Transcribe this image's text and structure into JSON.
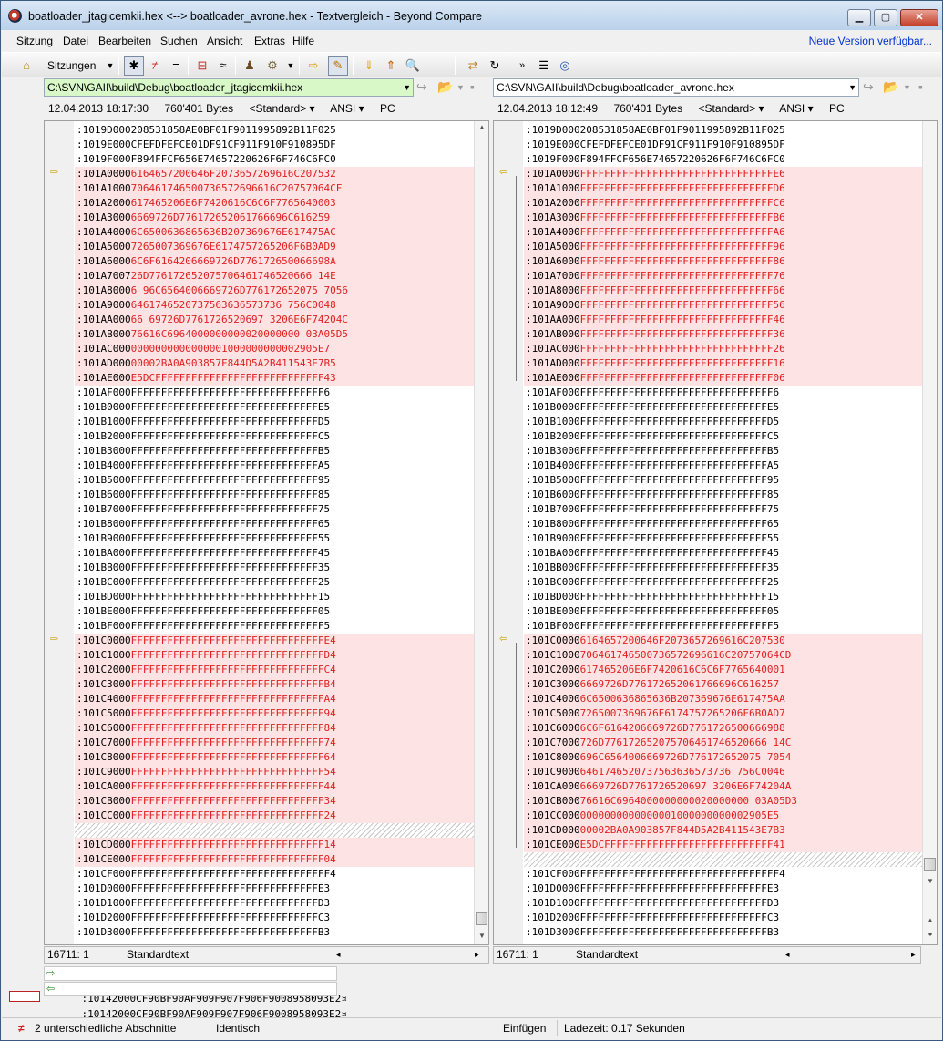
{
  "window": {
    "title": "boatloader_jtagicemkii.hex <--> boatloader_avrone.hex - Textvergleich - Beyond Compare",
    "minimize": "▁",
    "maximize": "▢",
    "close": "✕"
  },
  "menu": {
    "items": [
      "Sitzung",
      "Datei",
      "Bearbeiten",
      "Suchen",
      "Ansicht",
      "Extras",
      "Hilfe"
    ],
    "update_link": "Neue Version verfügbar..."
  },
  "toolbar": {
    "sessions_label": "Sitzungen",
    "icons": [
      "home-icon",
      "asterisk-filter-icon",
      "not-equal-icon",
      "equal-icon",
      "context-icon",
      "similar-icon",
      "rules-icon",
      "format-icon",
      "next-diff-icon",
      "edit-icon",
      "next-section-icon",
      "prev-section-icon",
      "find-icon",
      "swap-icon",
      "refresh-icon",
      "expand-icon",
      "report-icon",
      "web-icon"
    ]
  },
  "left": {
    "path": "C:\\SVN\\GAII\\build\\Debug\\boatloader_jtagicemkii.hex",
    "date": "12.04.2013 18:17:30",
    "size": "760'401 Bytes",
    "format": "<Standard> ▾",
    "encoding": "ANSI ▾",
    "lineend": "PC",
    "position": "16711: 1",
    "mode": "Standardtext",
    "lines": [
      {
        "t": ":1019D000208531858AE0BF01F9011995892B11F025",
        "d": 0
      },
      {
        "t": ":1019E000CFEFDFEFCE01DF91CF911F910F910895DF",
        "d": 0
      },
      {
        "t": ":1019F000F894FFCF656E74657220626F6F746C6FC0",
        "d": 0
      },
      {
        "t": ":101A00006164657200646F2073657269616C207532",
        "d": 1
      },
      {
        "t": ":101A1000706461746500736572696616C20757064CF",
        "d": 1
      },
      {
        "t": ":101A2000617465206E6F7420616C6C6F7765640003",
        "d": 1
      },
      {
        "t": ":101A30006669726D776172652061766696C616259",
        "d": 1
      },
      {
        "t": ":101A40006C6500636865636B207369676E617475AC",
        "d": 1
      },
      {
        "t": ":101A50007265007369676E6174757265206F6B0AD9",
        "d": 1
      },
      {
        "t": ":101A60006C6F6164206669726D776172650066698A",
        "d": 1
      },
      {
        "t": ":101A700726D776172652075706461746520666 14E",
        "d": 1
      },
      {
        "t": ":101A80006 96C6564006669726D776172652075 7056",
        "d": 1
      },
      {
        "t": ":101A90006461746520737563636573736 756C0048",
        "d": 1
      },
      {
        "t": ":101AA00066 69726D7761726520697 3206E6F74204C",
        "d": 1
      },
      {
        "t": ":101AB00076616C6964000000000020000000 03A05D5",
        "d": 1
      },
      {
        "t": ":101AC0000000000000000001000000000002905E7",
        "d": 1
      },
      {
        "t": ":101AD00000002BA0A903857F844D5A2B411543E7B5",
        "d": 1
      },
      {
        "t": ":101AE000E5DCFFFFFFFFFFFFFFFFFFFFFFFFFFFF43",
        "d": 1
      },
      {
        "t": ":101AF000FFFFFFFFFFFFFFFFFFFFFFFFFFFFFFFF6",
        "d": 0
      },
      {
        "t": ":101B0000FFFFFFFFFFFFFFFFFFFFFFFFFFFFFFFE5",
        "d": 0
      },
      {
        "t": ":101B1000FFFFFFFFFFFFFFFFFFFFFFFFFFFFFFFD5",
        "d": 0
      },
      {
        "t": ":101B2000FFFFFFFFFFFFFFFFFFFFFFFFFFFFFFFC5",
        "d": 0
      },
      {
        "t": ":101B3000FFFFFFFFFFFFFFFFFFFFFFFFFFFFFFFB5",
        "d": 0
      },
      {
        "t": ":101B4000FFFFFFFFFFFFFFFFFFFFFFFFFFFFFFFA5",
        "d": 0
      },
      {
        "t": ":101B5000FFFFFFFFFFFFFFFFFFFFFFFFFFFFFFF95",
        "d": 0
      },
      {
        "t": ":101B6000FFFFFFFFFFFFFFFFFFFFFFFFFFFFFFF85",
        "d": 0
      },
      {
        "t": ":101B7000FFFFFFFFFFFFFFFFFFFFFFFFFFFFFFF75",
        "d": 0
      },
      {
        "t": ":101B8000FFFFFFFFFFFFFFFFFFFFFFFFFFFFFFF65",
        "d": 0
      },
      {
        "t": ":101B9000FFFFFFFFFFFFFFFFFFFFFFFFFFFFFFF55",
        "d": 0
      },
      {
        "t": ":101BA000FFFFFFFFFFFFFFFFFFFFFFFFFFFFFFF45",
        "d": 0
      },
      {
        "t": ":101BB000FFFFFFFFFFFFFFFFFFFFFFFFFFFFFFF35",
        "d": 0
      },
      {
        "t": ":101BC000FFFFFFFFFFFFFFFFFFFFFFFFFFFFFFF25",
        "d": 0
      },
      {
        "t": ":101BD000FFFFFFFFFFFFFFFFFFFFFFFFFFFFFFF15",
        "d": 0
      },
      {
        "t": ":101BE000FFFFFFFFFFFFFFFFFFFFFFFFFFFFFFF05",
        "d": 0
      },
      {
        "t": ":101BF000FFFFFFFFFFFFFFFFFFFFFFFFFFFFFFFF5",
        "d": 0
      },
      {
        "t": ":101C0000FFFFFFFFFFFFFFFFFFFFFFFFFFFFFFFFE4",
        "d": 1
      },
      {
        "t": ":101C1000FFFFFFFFFFFFFFFFFFFFFFFFFFFFFFFFD4",
        "d": 1
      },
      {
        "t": ":101C2000FFFFFFFFFFFFFFFFFFFFFFFFFFFFFFFFC4",
        "d": 1
      },
      {
        "t": ":101C3000FFFFFFFFFFFFFFFFFFFFFFFFFFFFFFFFB4",
        "d": 1
      },
      {
        "t": ":101C4000FFFFFFFFFFFFFFFFFFFFFFFFFFFFFFFFA4",
        "d": 1
      },
      {
        "t": ":101C5000FFFFFFFFFFFFFFFFFFFFFFFFFFFFFFFF94",
        "d": 1
      },
      {
        "t": ":101C6000FFFFFFFFFFFFFFFFFFFFFFFFFFFFFFFF84",
        "d": 1
      },
      {
        "t": ":101C7000FFFFFFFFFFFFFFFFFFFFFFFFFFFFFFFF74",
        "d": 1
      },
      {
        "t": ":101C8000FFFFFFFFFFFFFFFFFFFFFFFFFFFFFFFF64",
        "d": 1
      },
      {
        "t": ":101C9000FFFFFFFFFFFFFFFFFFFFFFFFFFFFFFFF54",
        "d": 1
      },
      {
        "t": ":101CA000FFFFFFFFFFFFFFFFFFFFFFFFFFFFFFFF44",
        "d": 1
      },
      {
        "t": ":101CB000FFFFFFFFFFFFFFFFFFFFFFFFFFFFFFFF34",
        "d": 1
      },
      {
        "t": ":101CC000FFFFFFFFFFFFFFFFFFFFFFFFFFFFFFFF24",
        "d": 1
      },
      {
        "t": "",
        "d": 2
      },
      {
        "t": ":101CD000FFFFFFFFFFFFFFFFFFFFFFFFFFFFFFFF14",
        "d": 1
      },
      {
        "t": ":101CE000FFFFFFFFFFFFFFFFFFFFFFFFFFFFFFFF04",
        "d": 1
      },
      {
        "t": ":101CF000FFFFFFFFFFFFFFFFFFFFFFFFFFFFFFFFF4",
        "d": 0
      },
      {
        "t": ":101D0000FFFFFFFFFFFFFFFFFFFFFFFFFFFFFFFE3",
        "d": 0
      },
      {
        "t": ":101D1000FFFFFFFFFFFFFFFFFFFFFFFFFFFFFFFD3",
        "d": 0
      },
      {
        "t": ":101D2000FFFFFFFFFFFFFFFFFFFFFFFFFFFFFFFC3",
        "d": 0
      },
      {
        "t": ":101D3000FFFFFFFFFFFFFFFFFFFFFFFFFFFFFFFB3",
        "d": 0
      }
    ]
  },
  "right": {
    "path": "C:\\SVN\\GAII\\build\\Debug\\boatloader_avrone.hex",
    "date": "12.04.2013 18:12:49",
    "size": "760'401 Bytes",
    "format": "<Standard> ▾",
    "encoding": "ANSI ▾",
    "lineend": "PC",
    "position": "16711: 1",
    "mode": "Standardtext",
    "lines": [
      {
        "t": ":1019D000208531858AE0BF01F9011995892B11F025",
        "d": 0
      },
      {
        "t": ":1019E000CFEFDFEFCE01DF91CF911F910F910895DF",
        "d": 0
      },
      {
        "t": ":1019F000F894FFCF656E74657220626F6F746C6FC0",
        "d": 0
      },
      {
        "t": ":101A0000FFFFFFFFFFFFFFFFFFFFFFFFFFFFFFFFE6",
        "d": 1
      },
      {
        "t": ":101A1000FFFFFFFFFFFFFFFFFFFFFFFFFFFFFFFFD6",
        "d": 1
      },
      {
        "t": ":101A2000FFFFFFFFFFFFFFFFFFFFFFFFFFFFFFFFC6",
        "d": 1
      },
      {
        "t": ":101A3000FFFFFFFFFFFFFFFFFFFFFFFFFFFFFFFFB6",
        "d": 1
      },
      {
        "t": ":101A4000FFFFFFFFFFFFFFFFFFFFFFFFFFFFFFFFA6",
        "d": 1
      },
      {
        "t": ":101A5000FFFFFFFFFFFFFFFFFFFFFFFFFFFFFFFF96",
        "d": 1
      },
      {
        "t": ":101A6000FFFFFFFFFFFFFFFFFFFFFFFFFFFFFFFF86",
        "d": 1
      },
      {
        "t": ":101A7000FFFFFFFFFFFFFFFFFFFFFFFFFFFFFFFF76",
        "d": 1
      },
      {
        "t": ":101A8000FFFFFFFFFFFFFFFFFFFFFFFFFFFFFFFF66",
        "d": 1
      },
      {
        "t": ":101A9000FFFFFFFFFFFFFFFFFFFFFFFFFFFFFFFF56",
        "d": 1
      },
      {
        "t": ":101AA000FFFFFFFFFFFFFFFFFFFFFFFFFFFFFFFF46",
        "d": 1
      },
      {
        "t": ":101AB000FFFFFFFFFFFFFFFFFFFFFFFFFFFFFFFF36",
        "d": 1
      },
      {
        "t": ":101AC000FFFFFFFFFFFFFFFFFFFFFFFFFFFFFFFF26",
        "d": 1
      },
      {
        "t": ":101AD000FFFFFFFFFFFFFFFFFFFFFFFFFFFFFFFF16",
        "d": 1
      },
      {
        "t": ":101AE000FFFFFFFFFFFFFFFFFFFFFFFFFFFFFFFF06",
        "d": 1
      },
      {
        "t": ":101AF000FFFFFFFFFFFFFFFFFFFFFFFFFFFFFFFF6",
        "d": 0
      },
      {
        "t": ":101B0000FFFFFFFFFFFFFFFFFFFFFFFFFFFFFFFE5",
        "d": 0
      },
      {
        "t": ":101B1000FFFFFFFFFFFFFFFFFFFFFFFFFFFFFFFD5",
        "d": 0
      },
      {
        "t": ":101B2000FFFFFFFFFFFFFFFFFFFFFFFFFFFFFFFC5",
        "d": 0
      },
      {
        "t": ":101B3000FFFFFFFFFFFFFFFFFFFFFFFFFFFFFFFB5",
        "d": 0
      },
      {
        "t": ":101B4000FFFFFFFFFFFFFFFFFFFFFFFFFFFFFFFA5",
        "d": 0
      },
      {
        "t": ":101B5000FFFFFFFFFFFFFFFFFFFFFFFFFFFFFFF95",
        "d": 0
      },
      {
        "t": ":101B6000FFFFFFFFFFFFFFFFFFFFFFFFFFFFFFF85",
        "d": 0
      },
      {
        "t": ":101B7000FFFFFFFFFFFFFFFFFFFFFFFFFFFFFFF75",
        "d": 0
      },
      {
        "t": ":101B8000FFFFFFFFFFFFFFFFFFFFFFFFFFFFFFF65",
        "d": 0
      },
      {
        "t": ":101B9000FFFFFFFFFFFFFFFFFFFFFFFFFFFFFFF55",
        "d": 0
      },
      {
        "t": ":101BA000FFFFFFFFFFFFFFFFFFFFFFFFFFFFFFF45",
        "d": 0
      },
      {
        "t": ":101BB000FFFFFFFFFFFFFFFFFFFFFFFFFFFFFFF35",
        "d": 0
      },
      {
        "t": ":101BC000FFFFFFFFFFFFFFFFFFFFFFFFFFFFFFF25",
        "d": 0
      },
      {
        "t": ":101BD000FFFFFFFFFFFFFFFFFFFFFFFFFFFFFFF15",
        "d": 0
      },
      {
        "t": ":101BE000FFFFFFFFFFFFFFFFFFFFFFFFFFFFFFF05",
        "d": 0
      },
      {
        "t": ":101BF000FFFFFFFFFFFFFFFFFFFFFFFFFFFFFFFF5",
        "d": 0
      },
      {
        "t": ":101C00006164657200646F2073657269616C207530",
        "d": 1
      },
      {
        "t": ":101C1000706461746500736572696616C20757064CD",
        "d": 1
      },
      {
        "t": ":101C2000617465206E6F7420616C6C6F7765640001",
        "d": 1
      },
      {
        "t": ":101C30006669726D776172652061766696C616257",
        "d": 1
      },
      {
        "t": ":101C40006C6500636865636B207369676E617475AA",
        "d": 1
      },
      {
        "t": ":101C50007265007369676E6174757265206F6B0AD7",
        "d": 1
      },
      {
        "t": ":101C60006C6F6164206669726D7761726500666988",
        "d": 1
      },
      {
        "t": ":101C7000726D776172652075706461746520666 14C",
        "d": 1
      },
      {
        "t": ":101C8000696C6564006669726D776172652075 7054",
        "d": 1
      },
      {
        "t": ":101C90006461746520737563636573736 756C0046",
        "d": 1
      },
      {
        "t": ":101CA0006669726D7761726520697 3206E6F74204A",
        "d": 1
      },
      {
        "t": ":101CB00076616C6964000000000020000000 03A05D3",
        "d": 1
      },
      {
        "t": ":101CC0000000000000000001000000000002905E5",
        "d": 1
      },
      {
        "t": ":101CD00000002BA0A903857F844D5A2B411543E7B3",
        "d": 1
      },
      {
        "t": ":101CE000E5DCFFFFFFFFFFFFFFFFFFFFFFFFFFFF41",
        "d": 1
      },
      {
        "t": "",
        "d": 2
      },
      {
        "t": ":101CF000FFFFFFFFFFFFFFFFFFFFFFFFFFFFFFFFF4",
        "d": 0
      },
      {
        "t": ":101D0000FFFFFFFFFFFFFFFFFFFFFFFFFFFFFFFE3",
        "d": 0
      },
      {
        "t": ":101D1000FFFFFFFFFFFFFFFFFFFFFFFFFFFFFFFD3",
        "d": 0
      },
      {
        "t": ":101D2000FFFFFFFFFFFFFFFFFFFFFFFFFFFFFFFC3",
        "d": 0
      },
      {
        "t": ":101D3000FFFFFFFFFFFFFFFFFFFFFFFFFFFFFFFB3",
        "d": 0
      }
    ]
  },
  "compare": {
    "line1": ":10142000CF90BF90AF909F907F906F9008958093E2¤",
    "line2": ":10142000CF90BF90AF909F907F906F9008958093E2¤"
  },
  "status": {
    "diff_sections": "2 unterschiedliche Abschnitte",
    "identical": "Identisch",
    "insert_mode": "Einfügen",
    "load_time": "Ladezeit: 0.17 Sekunden"
  },
  "colors": {
    "diff_bg": "#fde3e3",
    "diff_text": "#e02020",
    "left_path_bg": "#d8f8c8",
    "marker": "#c9a400"
  }
}
